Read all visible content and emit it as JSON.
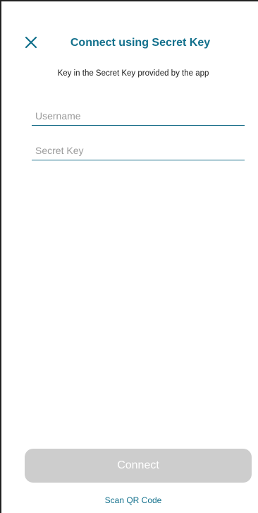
{
  "header": {
    "title": "Connect using Secret Key",
    "close_icon": "close-icon"
  },
  "subtitle": "Key in the Secret Key provided by the app",
  "form": {
    "username": {
      "placeholder": "Username",
      "value": ""
    },
    "secret_key": {
      "placeholder": "Secret Key",
      "value": ""
    }
  },
  "actions": {
    "connect_label": "Connect",
    "connect_enabled": false,
    "scan_qr_label": "Scan QR Code"
  },
  "colors": {
    "accent": "#12708c",
    "disabled_button": "#cdcdcd",
    "underline": "#1b6f8a"
  }
}
